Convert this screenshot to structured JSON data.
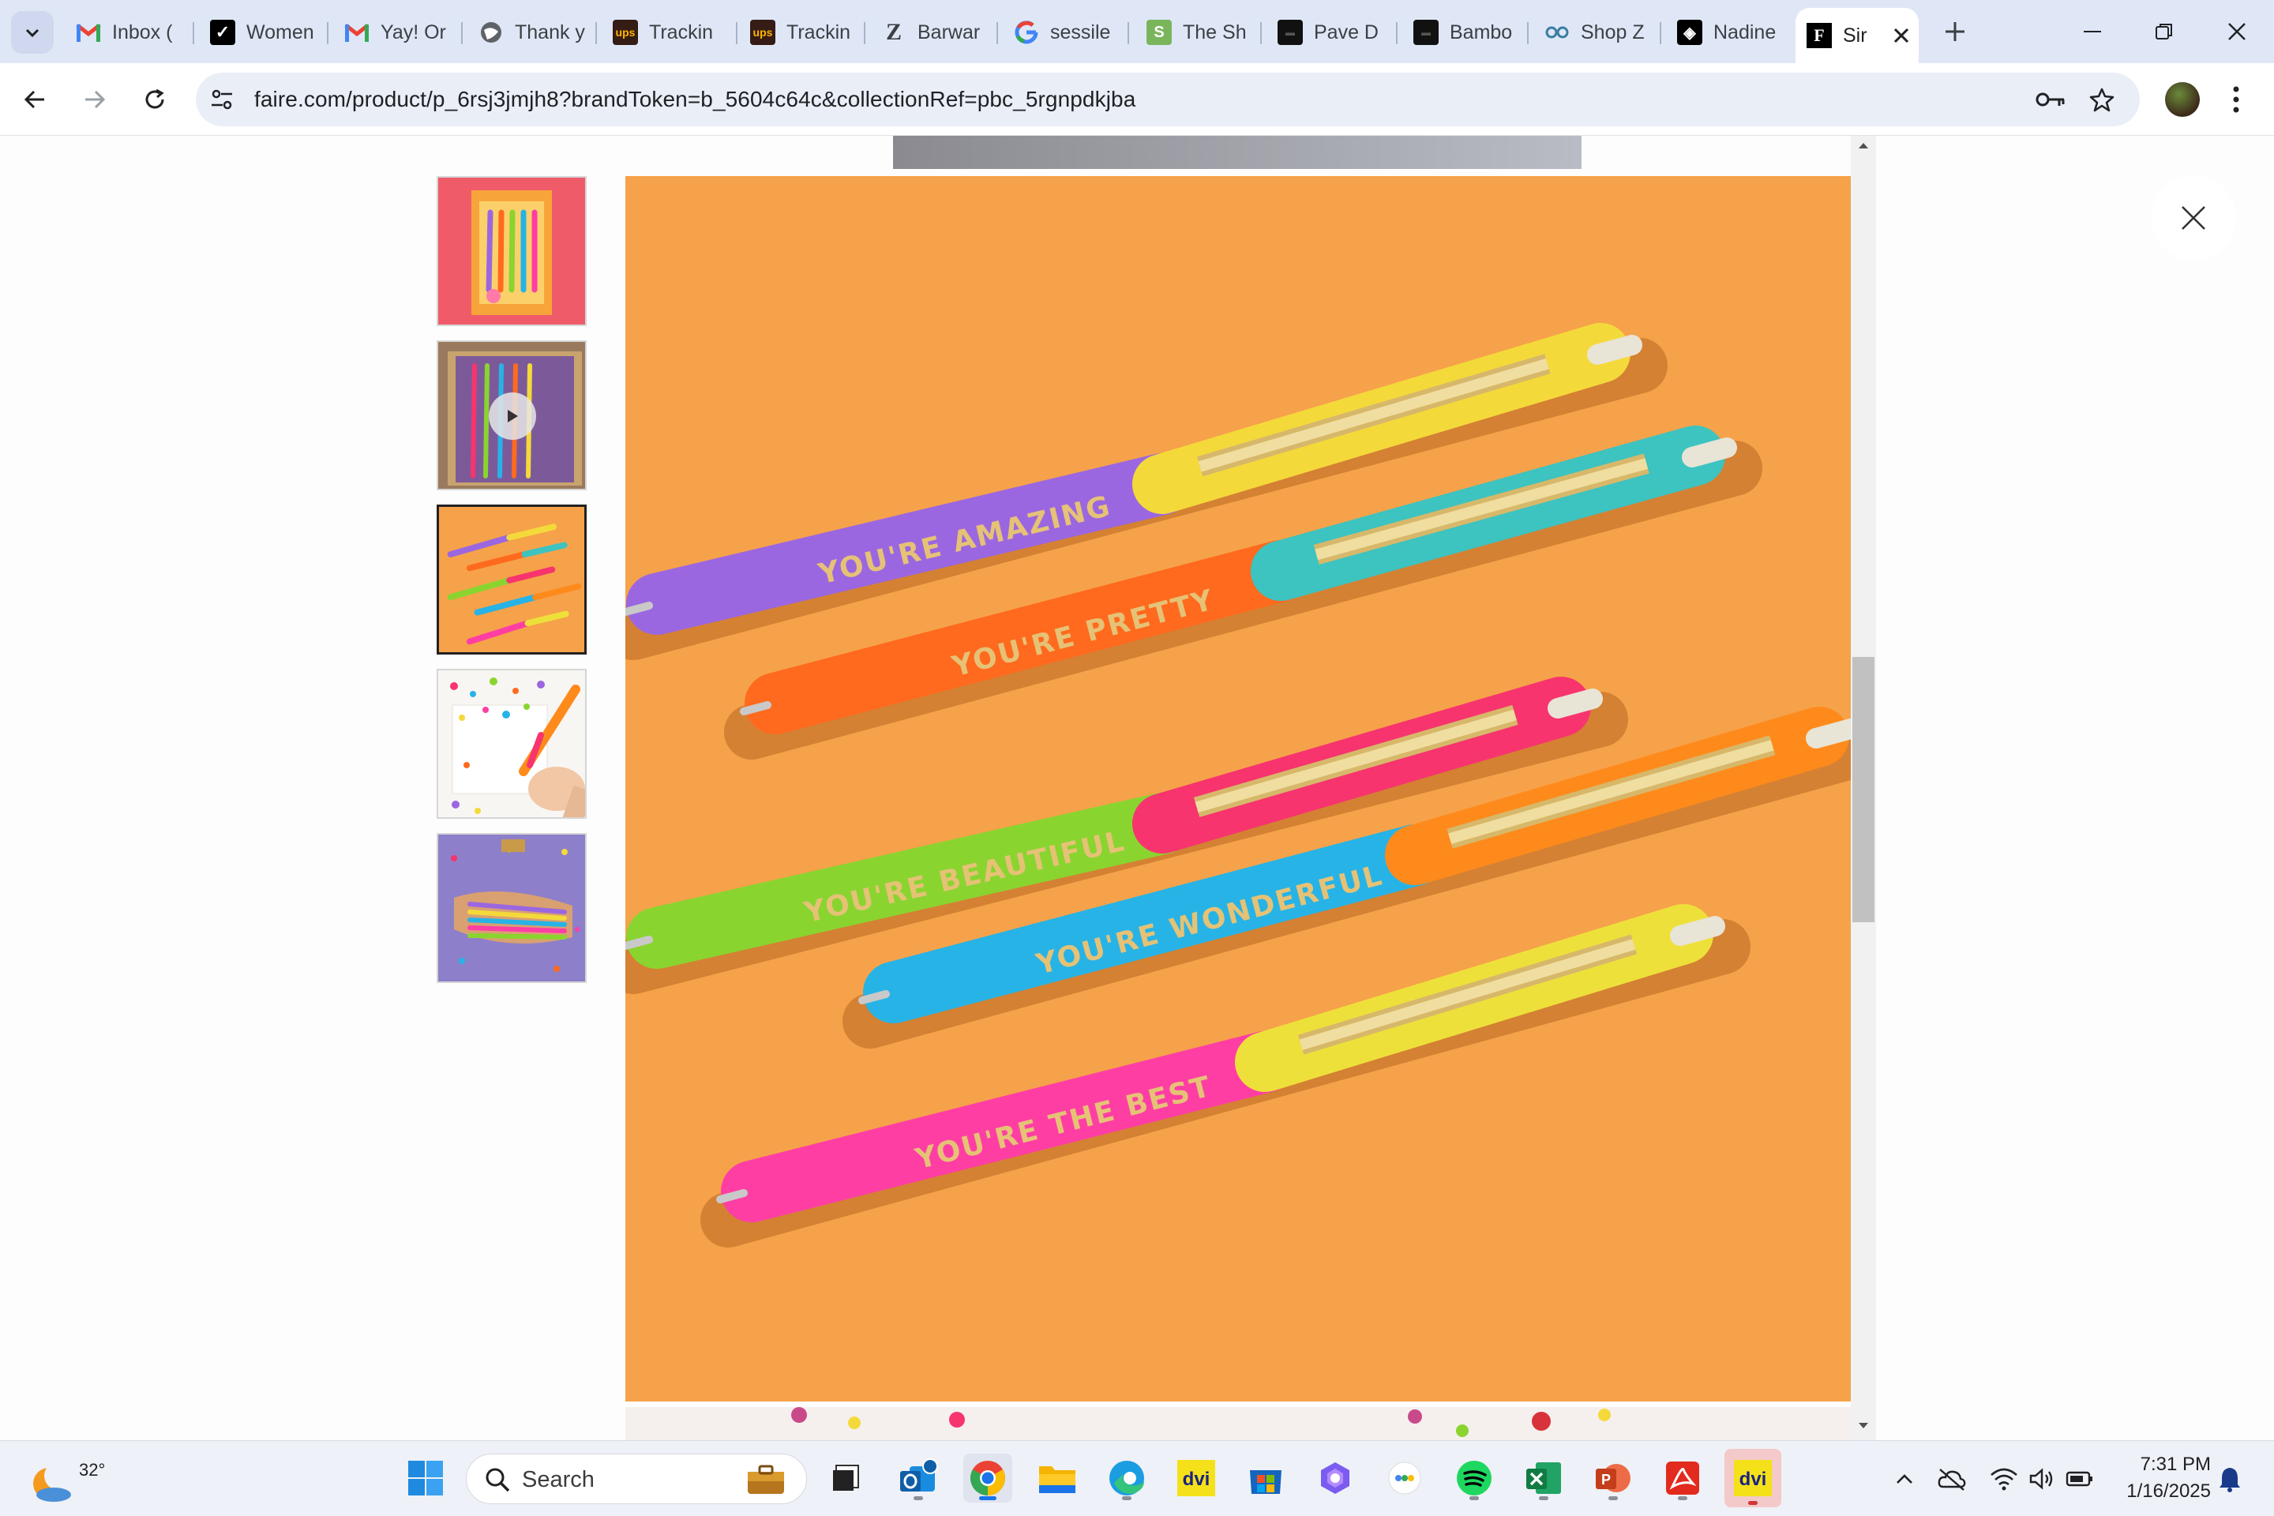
{
  "browser": {
    "tabs": [
      {
        "title": "Inbox (",
        "icon": "gmail-icon"
      },
      {
        "title": "Women",
        "icon": "brand-icon"
      },
      {
        "title": "Yay! Or",
        "icon": "gmail-icon"
      },
      {
        "title": "Thank y",
        "icon": "globe-icon"
      },
      {
        "title": "Trackin",
        "icon": "ups-icon"
      },
      {
        "title": "Trackin",
        "icon": "ups-icon"
      },
      {
        "title": "Barwar",
        "icon": "z-icon"
      },
      {
        "title": "sessile",
        "icon": "google-icon"
      },
      {
        "title": "The Sh",
        "icon": "shopify-icon"
      },
      {
        "title": "Pave D",
        "icon": "pave-icon"
      },
      {
        "title": "Bambo",
        "icon": "bamboo-icon"
      },
      {
        "title": "Shop Z",
        "icon": "shop-icon"
      },
      {
        "title": "Nadine",
        "icon": "nadine-icon"
      }
    ],
    "active_tab": {
      "title": "Sir",
      "favicon_letter": "F"
    },
    "url": "faire.com/product/p_6rsj3jmjh8?brandToken=b_5604c64c&collectionRef=pbc_5rgnpdkjba"
  },
  "gallery": {
    "selected_index": 2,
    "thumbnails": [
      {
        "name": "thumb-pen-set-box"
      },
      {
        "name": "thumb-video",
        "has_play": true
      },
      {
        "name": "thumb-pens-orange"
      },
      {
        "name": "thumb-confetti-writing"
      },
      {
        "name": "thumb-hands-holding-pens"
      }
    ],
    "pens": [
      {
        "text": "YOU'RE AMAZING",
        "barrel": "#9b67e0",
        "cap": "#f4d93a"
      },
      {
        "text": "YOU'RE PRETTY",
        "barrel": "#ff6a1e",
        "cap": "#3dc3c0"
      },
      {
        "text": "YOU'RE BEAUTIFUL",
        "barrel": "#8ad42f",
        "cap": "#f7346e"
      },
      {
        "text": "YOU'RE WONDERFUL",
        "barrel": "#27b3e6",
        "cap": "#ff8a1c"
      },
      {
        "text": "YOU'RE THE BEST",
        "barrel": "#ff3ea4",
        "cap": "#eee03a"
      }
    ],
    "background_color": "#f6a24a"
  },
  "taskbar": {
    "weather_temp": "32°",
    "search_label": "Search",
    "apps": [
      "file-explorer-widgets-icon",
      "task-view-icon",
      "outlook-icon",
      "chrome-icon",
      "folder-icon",
      "edge-icon",
      "dvi-icon",
      "store-icon",
      "copilot-icon",
      "pinwheel-icon",
      "spotify-icon",
      "excel-icon",
      "powerpoint-icon",
      "acrobat-icon",
      "dvi-active-icon"
    ],
    "time": "7:31 PM",
    "date": "1/16/2025"
  }
}
